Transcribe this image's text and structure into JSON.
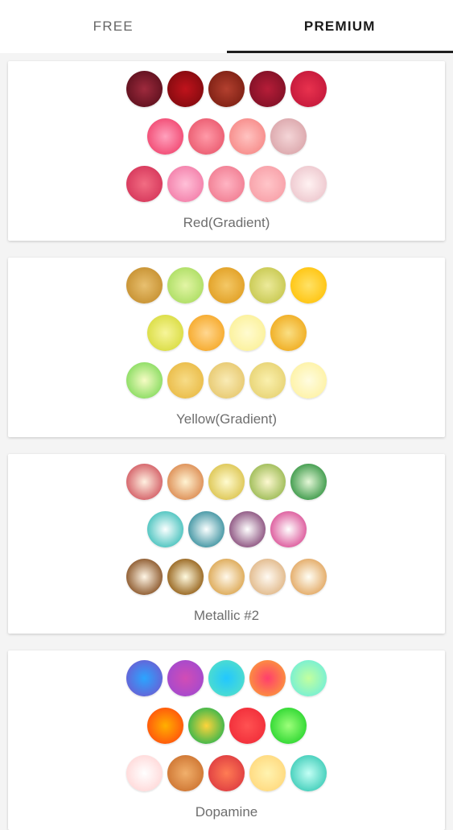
{
  "tabs": {
    "free": "FREE",
    "premium": "PREMIUM",
    "active": "premium"
  },
  "palettes": [
    {
      "title": "Red(Gradient)",
      "rows": [
        [
          [
            "#9e2a3d",
            "#5a0f1c"
          ],
          [
            "#c0131c",
            "#7f0a0e"
          ],
          [
            "#b3402f",
            "#7a1e12"
          ],
          [
            "#b61d38",
            "#7d1025"
          ],
          [
            "#e8324e",
            "#c2173a"
          ]
        ],
        [
          [
            "#ffa1bd",
            "#f0426c"
          ],
          [
            "#ff9aa8",
            "#e9576c"
          ],
          [
            "#ffc3c1",
            "#f68785"
          ],
          [
            "#f4d5d7",
            "#d9a3a8"
          ]
        ],
        [
          [
            "#f26d83",
            "#d43358"
          ],
          [
            "#ffc0d8",
            "#f27aa6"
          ],
          [
            "#ffb4c3",
            "#f07a8f"
          ],
          [
            "#ffc5c9",
            "#f79ea6"
          ],
          [
            "#fff2f2",
            "#ecc4cb"
          ]
        ]
      ]
    },
    {
      "title": "Yellow(Gradient)",
      "rows": [
        [
          [
            "#e8c070",
            "#c48d2c"
          ],
          [
            "#e3f5a5",
            "#a8dc5e"
          ],
          [
            "#f4c866",
            "#e09d20"
          ],
          [
            "#ecea9a",
            "#c5c64b"
          ],
          [
            "#ffe266",
            "#ffc107"
          ]
        ],
        [
          [
            "#f7f59a",
            "#d7da3b"
          ],
          [
            "#ffd791",
            "#f5a521"
          ],
          [
            "#fffbd0",
            "#fbf096"
          ],
          [
            "#fadf84",
            "#efa818"
          ]
        ],
        [
          [
            "#f6fcc4",
            "#7ed957"
          ],
          [
            "#f7dc87",
            "#e9b943"
          ],
          [
            "#f9ebb5",
            "#e6c66a"
          ],
          [
            "#faf0ad",
            "#e6d170"
          ],
          [
            "#fffce0",
            "#fdf1a0"
          ]
        ]
      ]
    },
    {
      "title": "Metallic #2",
      "rows": [
        [
          [
            "#fff0e0",
            "#cf4f59"
          ],
          [
            "#fff3d2",
            "#d98246"
          ],
          [
            "#fffbcf",
            "#d9c046"
          ],
          [
            "#fdf8d0",
            "#93b549"
          ],
          [
            "#e4f7d7",
            "#2a8f3a"
          ]
        ],
        [
          [
            "#fbffff",
            "#36bcb7"
          ],
          [
            "#fbffff",
            "#2b8897"
          ],
          [
            "#ffffff",
            "#7e3e70"
          ],
          [
            "#ffffff",
            "#d8458f"
          ]
        ],
        [
          [
            "#fff6e6",
            "#7e4515"
          ],
          [
            "#fffadf",
            "#8a5206"
          ],
          [
            "#fff8ea",
            "#d9a045"
          ],
          [
            "#fffaf2",
            "#deb27f"
          ],
          [
            "#fffef4",
            "#e0a055"
          ]
        ]
      ]
    },
    {
      "title": "Dopamine",
      "rows": [
        [
          [
            "#2ba5ff",
            "#6d5bd2"
          ],
          [
            "#d24cb5",
            "#a04ad0"
          ],
          [
            "#22c7ff",
            "#52dfc9"
          ],
          [
            "#ff3e6d",
            "#fb9a3a"
          ],
          [
            "#c3ff9e",
            "#6feeda"
          ]
        ],
        [
          [
            "#ffb000",
            "#ff4b0e"
          ],
          [
            "#ffd43b",
            "#24b34e"
          ],
          [
            "#ff5252",
            "#f02b38"
          ],
          [
            "#9dff7a",
            "#23d32b"
          ]
        ],
        [
          [
            "#ffffff",
            "#ffd5d5"
          ],
          [
            "#f1b06c",
            "#cb702d"
          ],
          [
            "#ff7c54",
            "#dc3840"
          ],
          [
            "#fff3b0",
            "#ffd77a"
          ],
          [
            "#c3fff5",
            "#35c9b4"
          ]
        ]
      ]
    }
  ]
}
